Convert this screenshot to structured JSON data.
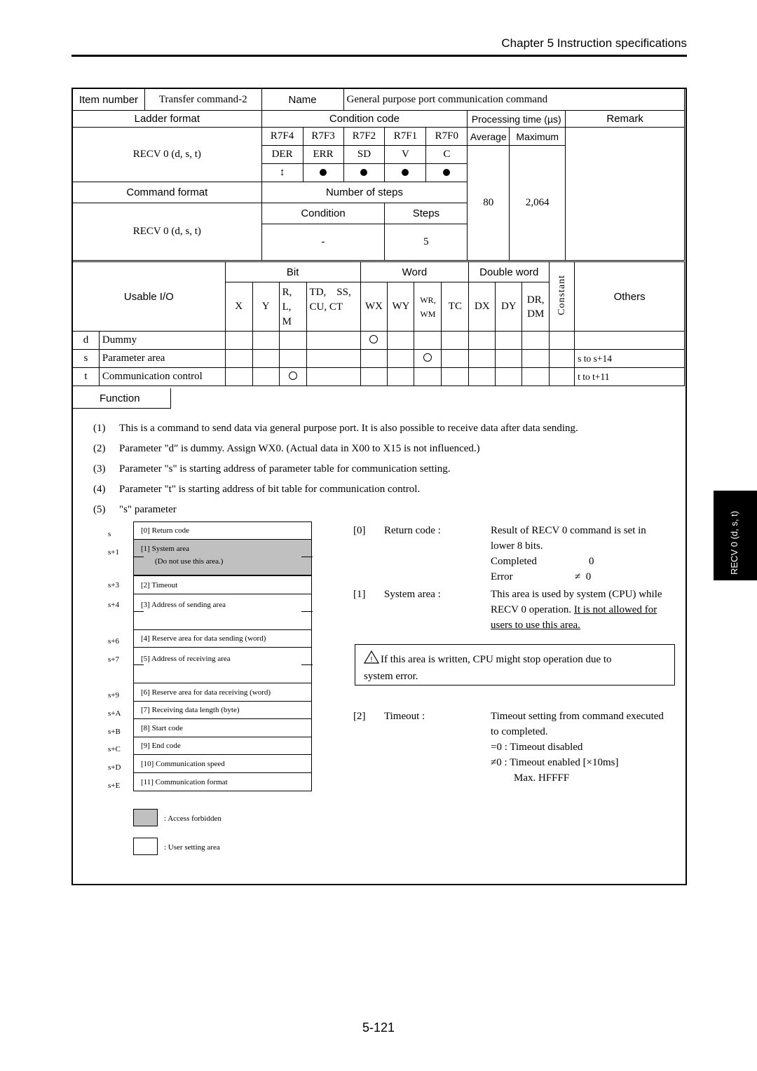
{
  "header": {
    "chapter_title": "Chapter 5   Instruction specifications"
  },
  "spec": {
    "item_number_label": "Item number",
    "item_number_value": "Transfer command-2",
    "name_label": "Name",
    "name_value": "General purpose port communication command",
    "ladder_format_label": "Ladder format",
    "ladder_format_value": "RECV 0 (d, s, t)",
    "condition_code_label": "Condition code",
    "condition_registers": [
      "R7F4",
      "R7F3",
      "R7F2",
      "R7F1",
      "R7F0"
    ],
    "condition_names": [
      "DER",
      "ERR",
      "SD",
      "V",
      "C"
    ],
    "condition_marks": [
      "↕",
      "●",
      "●",
      "●",
      "●"
    ],
    "processing_time_label": "Processing time (µs)",
    "average_label": "Average",
    "maximum_label": "Maximum",
    "average_value": "80",
    "maximum_value": "2,064",
    "remark_label": "Remark",
    "command_format_label": "Command format",
    "command_format_value": "RECV 0 (d, s, t)",
    "number_of_steps_label": "Number of steps",
    "condition_label": "Condition",
    "steps_label": "Steps",
    "condition_value": "-",
    "steps_value": "5"
  },
  "io": {
    "usable_io_label": "Usable I/O",
    "groups": {
      "bit": "Bit",
      "word": "Word",
      "double_word": "Double word",
      "constant": "Constant",
      "others": "Others"
    },
    "columns": [
      "X",
      "Y",
      "R,\nL,\nM",
      "TD,    SS,\nCU, CT",
      "WX",
      "WY",
      "WR,\nWM",
      "TC",
      "DX",
      "DY",
      "DR,\nDM"
    ],
    "col_x": "X",
    "col_y": "Y",
    "col_rlm_1": "R,",
    "col_rlm_2": "L,",
    "col_rlm_3": "M",
    "col_td_1": "TD,    SS,",
    "col_td_2": "CU, CT",
    "col_wx": "WX",
    "col_wy": "WY",
    "col_wr_1": "WR,",
    "col_wr_2": "WM",
    "col_tc": "TC",
    "col_dx": "DX",
    "col_dy": "DY",
    "col_dr_1": "DR,",
    "col_dr_2": "DM",
    "rows": [
      {
        "param": "d",
        "name": "Dummy",
        "allowed": "WX",
        "others": ""
      },
      {
        "param": "s",
        "name": "Parameter area",
        "allowed": "WR, WM",
        "others": "s to s+14"
      },
      {
        "param": "t",
        "name": "Communication control",
        "allowed": "R, L, M",
        "others": "t to t+11"
      }
    ]
  },
  "function": {
    "tab_label": "Function",
    "items": [
      {
        "num": "(1)",
        "text": "This is a command to send data via general purpose port. It is also possible to receive data after data sending."
      },
      {
        "num": "(2)",
        "text": "Parameter \"d\" is dummy. Assign WX0. (Actual data in X00 to X15 is not influenced.)"
      },
      {
        "num": "(3)",
        "text": "Parameter \"s\" is starting address of parameter table for communication setting."
      },
      {
        "num": "(4)",
        "text": "Parameter \"t\" is starting address of bit table for communication control."
      },
      {
        "num": "(5)",
        "text": "\"s\" parameter"
      }
    ]
  },
  "param_map": {
    "rows": [
      {
        "offset": "s",
        "label": "[0] Return code"
      },
      {
        "offset": "s+1",
        "label": "[1] System area",
        "sub": "(Do not use this area.)",
        "forbidden": true
      },
      {
        "offset": "s+3",
        "label": "[2] Timeout"
      },
      {
        "offset": "s+4",
        "label": "[3] Address of sending area"
      },
      {
        "offset": "s+6",
        "label": "[4] Reserve area for data sending (word)"
      },
      {
        "offset": "s+7",
        "label": "[5] Address of receiving area"
      },
      {
        "offset": "s+9",
        "label": "[6] Reserve area for data receiving (word)"
      },
      {
        "offset": "s+A",
        "label": "[7] Receiving data length (byte)"
      },
      {
        "offset": "s+B",
        "label": "[8] Start code"
      },
      {
        "offset": "s+C",
        "label": "[9] End code"
      },
      {
        "offset": "s+D",
        "label": "[10] Communication speed"
      },
      {
        "offset": "s+E",
        "label": "[11] Communication format"
      }
    ],
    "legend": [
      {
        "label": ": Access forbidden",
        "color": "#c0c0c0"
      },
      {
        "label": ": User setting area",
        "color": "#ffffff"
      }
    ]
  },
  "descriptions": {
    "return_code": {
      "idx": "[0]",
      "name": "Return code :",
      "line1": "Result of RECV 0 command is set in",
      "line2": "lower 8 bits.",
      "completed_label": "Completed",
      "completed_value": "0",
      "error_label": "Error",
      "error_value": "≠  0"
    },
    "system_area": {
      "idx": "[1]",
      "name": "System area :",
      "line1": "This area is used by system (CPU) while",
      "line2_plain": "RECV 0 operation. ",
      "line2_underlined": "It is not allowed for",
      "line3_underlined": "users to use this area."
    },
    "warning": {
      "icon": "warning-triangle",
      "line1": "If this area is written, CPU might stop operation due to",
      "line2": "system error."
    },
    "timeout": {
      "idx": "[2]",
      "name": "Timeout :",
      "line1": "Timeout setting from command executed",
      "line2": "to completed.",
      "line3": "=0 : Timeout disabled",
      "line4": "≠0 : Timeout enabled [×10ms]",
      "line5": "Max. HFFFF"
    }
  },
  "side_tab": {
    "label": "RECV 0 (d, s, t)"
  },
  "footer": {
    "page_number": "5-121"
  }
}
